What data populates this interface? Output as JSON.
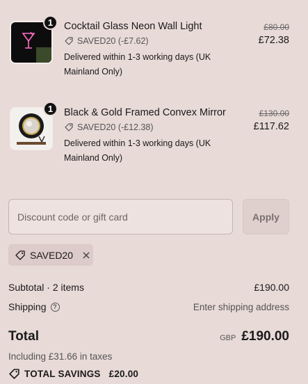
{
  "items": [
    {
      "quantity": "1",
      "name": "Cocktail Glass Neon Wall Light",
      "discount": "SAVED20 (-£7.62)",
      "delivery": "Delivered within 1-3 working days (UK Mainland Only)",
      "original_price": "£80.00",
      "price": "£72.38",
      "thumb_icon": "neon-cocktail-image"
    },
    {
      "quantity": "1",
      "name": "Black & Gold Framed Convex Mirror",
      "discount": "SAVED20 (-£12.38)",
      "delivery": "Delivered within 1-3 working days (UK Mainland Only)",
      "original_price": "£130.00",
      "price": "£117.62",
      "thumb_icon": "convex-mirror-image"
    }
  ],
  "discount_field": {
    "placeholder": "Discount code or gift card"
  },
  "apply_label": "Apply",
  "applied_code": "SAVED20",
  "summary": {
    "subtotal_label": "Subtotal · 2 items",
    "subtotal_value": "£190.00",
    "shipping_label": "Shipping",
    "shipping_value": "Enter shipping address",
    "total_label": "Total",
    "currency": "GBP",
    "total_value": "£190.00",
    "taxes_note": "Including £31.66 in taxes",
    "savings_label": "TOTAL SAVINGS",
    "savings_value": "£20.00"
  },
  "colors": {
    "background": "#e8dad7",
    "text": "#1a1a1a",
    "muted": "#555555"
  }
}
